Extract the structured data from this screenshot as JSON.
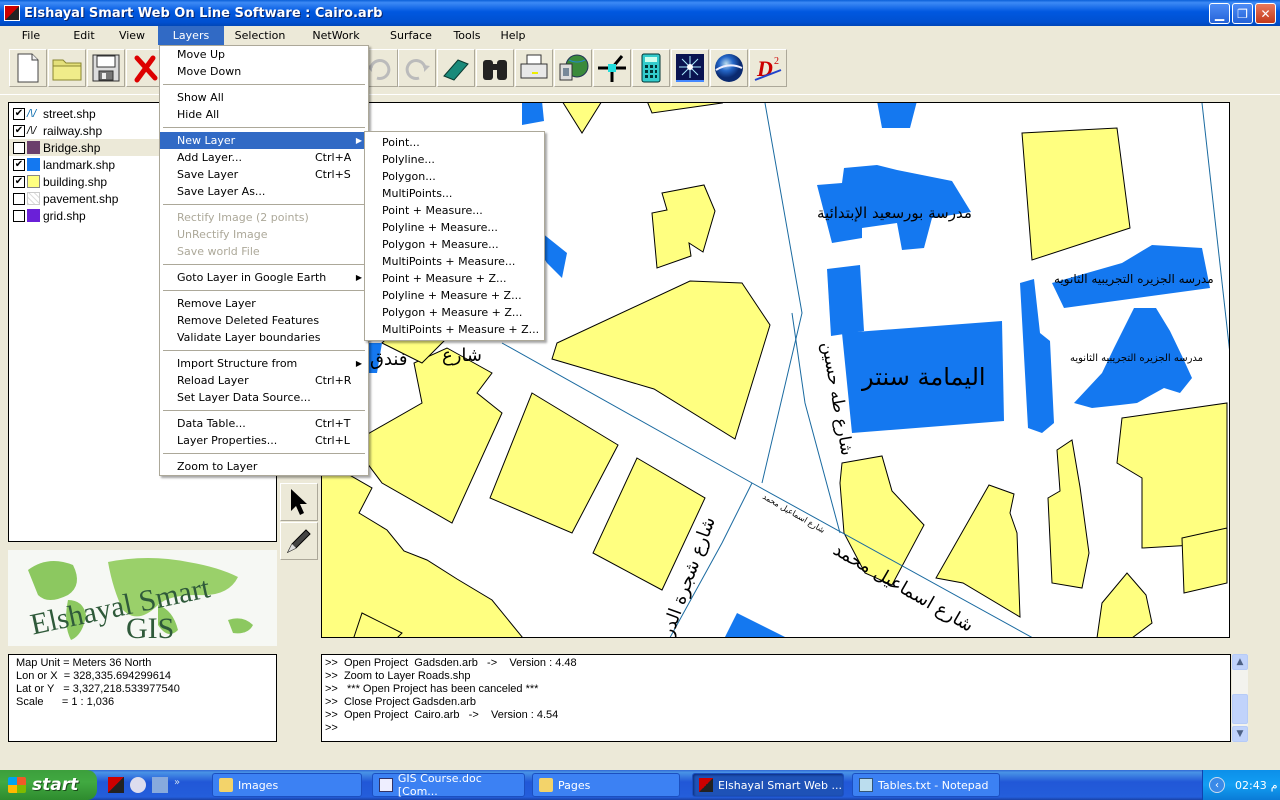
{
  "window": {
    "title": "Elshayal Smart Web On Line Software : Cairo.arb",
    "controls": [
      "minimize",
      "restore",
      "close"
    ]
  },
  "menubar": {
    "items": [
      {
        "label": "File"
      },
      {
        "label": "Edit"
      },
      {
        "label": "View"
      },
      {
        "label": "Layers",
        "active": true
      },
      {
        "label": "Selection"
      },
      {
        "label": "NetWork"
      },
      {
        "label": "Surface"
      },
      {
        "label": "Tools"
      },
      {
        "label": "Help"
      }
    ]
  },
  "toolbar": {
    "buttons": [
      {
        "icon": "new-file-icon"
      },
      {
        "icon": "open-folder-icon"
      },
      {
        "icon": "save-disk-icon"
      },
      {
        "icon": "delete-x-icon"
      },
      {
        "icon": "undo-icon",
        "disabled": true
      },
      {
        "icon": "redo-icon",
        "disabled": true
      },
      {
        "icon": "eraser-icon"
      },
      {
        "icon": "binoculars-icon"
      },
      {
        "icon": "printer-icon"
      },
      {
        "icon": "globe-document-icon"
      },
      {
        "icon": "crosshair-node-icon"
      },
      {
        "icon": "calculator-icon"
      },
      {
        "icon": "star-burst-icon"
      },
      {
        "icon": "google-earth-icon"
      },
      {
        "icon": "d-squared-icon"
      }
    ]
  },
  "layers": {
    "items": [
      {
        "name": "street.shp",
        "checked": true,
        "symbol": "line",
        "color": "#0066aa"
      },
      {
        "name": "railway.shp",
        "checked": true,
        "symbol": "line",
        "color": "#000000"
      },
      {
        "name": "Bridge.shp",
        "checked": false,
        "symbol": "fill",
        "color": "#6b3f6b",
        "selected": true
      },
      {
        "name": "landmark.shp",
        "checked": true,
        "symbol": "fill",
        "color": "#1478F0"
      },
      {
        "name": "building.shp",
        "checked": true,
        "symbol": "fill",
        "color": "#FFFF80"
      },
      {
        "name": "pavement.shp",
        "checked": false,
        "symbol": "hatch",
        "color": "#e8e8e8"
      },
      {
        "name": "grid.shp",
        "checked": false,
        "symbol": "fill",
        "color": "#6a20d8"
      }
    ]
  },
  "logo": {
    "line1": "Elshayal Smart",
    "line2": "GIS"
  },
  "coords": {
    "rows": [
      "Map Unit = Meters 36 North",
      "Lon or X  = 328,335.694299614",
      "Lat or Y   = 3,327,218.533977540",
      "Scale      = 1 : 1,036"
    ]
  },
  "layers_menu": {
    "items": [
      {
        "label": "Move Up"
      },
      {
        "label": "Move Down"
      },
      {
        "sep": true
      },
      {
        "label": "Show All"
      },
      {
        "label": "Hide All"
      },
      {
        "sep": true
      },
      {
        "label": "New Layer",
        "submenu": true,
        "highlighted": true
      },
      {
        "label": "Add Layer...",
        "shortcut": "Ctrl+A"
      },
      {
        "label": "Save Layer",
        "shortcut": "Ctrl+S"
      },
      {
        "label": "Save Layer As..."
      },
      {
        "sep": true
      },
      {
        "label": "Rectify Image (2 points)",
        "disabled": true
      },
      {
        "label": "UnRectify Image",
        "disabled": true
      },
      {
        "label": "Save world File",
        "disabled": true
      },
      {
        "sep": true
      },
      {
        "label": "Goto Layer in Google Earth",
        "submenu": true
      },
      {
        "sep": true
      },
      {
        "label": "Remove Layer"
      },
      {
        "label": "Remove Deleted Features"
      },
      {
        "label": "Validate Layer boundaries"
      },
      {
        "sep": true
      },
      {
        "label": "Import Structure from",
        "submenu": true
      },
      {
        "label": "Reload Layer",
        "shortcut": "Ctrl+R"
      },
      {
        "label": "Set Layer Data Source..."
      },
      {
        "sep": true
      },
      {
        "label": "Data Table...",
        "shortcut": "Ctrl+T"
      },
      {
        "label": "Layer Properties...",
        "shortcut": "Ctrl+L"
      },
      {
        "sep": true
      },
      {
        "label": "Zoom to Layer"
      }
    ]
  },
  "new_layer_submenu": {
    "items": [
      "Point...",
      "Polyline...",
      "Polygon...",
      "MultiPoints...",
      "Point + Measure...",
      "Polyline + Measure...",
      "Polygon + Measure...",
      "MultiPoints + Measure...",
      "Point + Measure + Z...",
      "Polyline + Measure + Z...",
      "Polygon + Measure + Z...",
      "MultiPoints + Measure + Z..."
    ]
  },
  "map": {
    "colors": {
      "building": "#FFFF80",
      "landmark": "#1478F0",
      "street": "#1a6aa0"
    },
    "labels": [
      {
        "text": "مدرسة بورسعيد الإبتدائية",
        "kind": "landmark"
      },
      {
        "text": "مدرسه الجزيره التجريبيه الثانويه",
        "kind": "landmark"
      },
      {
        "text": "مدرسه الجزيره التجريبيه الثانويه",
        "kind": "landmark-small"
      },
      {
        "text": "اليمامة سنتر",
        "kind": "landmark-large"
      },
      {
        "text": "شارع طه حسين",
        "kind": "street"
      },
      {
        "text": "شارع اسماعيل محمد",
        "kind": "street"
      },
      {
        "text": "شارع اسماعيل محمد",
        "kind": "street-small"
      },
      {
        "text": "شارع شجرة الدر",
        "kind": "street"
      },
      {
        "text": "فندق",
        "kind": "landmark"
      },
      {
        "text": "شارع",
        "kind": "street"
      }
    ]
  },
  "log": {
    "lines": [
      ">>  Open Project  Gadsden.arb   ->    Version : 4.48",
      ">>  Zoom to Layer Roads.shp",
      ">>   *** Open Project has been canceled ***",
      ">>  Close Project Gadsden.arb",
      ">>  Open Project  Cairo.arb   ->    Version : 4.54",
      ">>"
    ]
  },
  "taskbar": {
    "start_label": "start",
    "tasks": [
      {
        "label": "Images",
        "icon": "folder-icon"
      },
      {
        "label": "GIS Course.doc [Com...",
        "icon": "word-doc-icon"
      },
      {
        "label": "Pages",
        "icon": "folder-icon"
      },
      {
        "label": "Elshayal Smart Web ...",
        "icon": "app-icon",
        "active": true
      },
      {
        "label": "Tables.txt - Notepad",
        "icon": "notepad-icon"
      }
    ],
    "clock": "02:43",
    "clock_suffix": "م"
  }
}
